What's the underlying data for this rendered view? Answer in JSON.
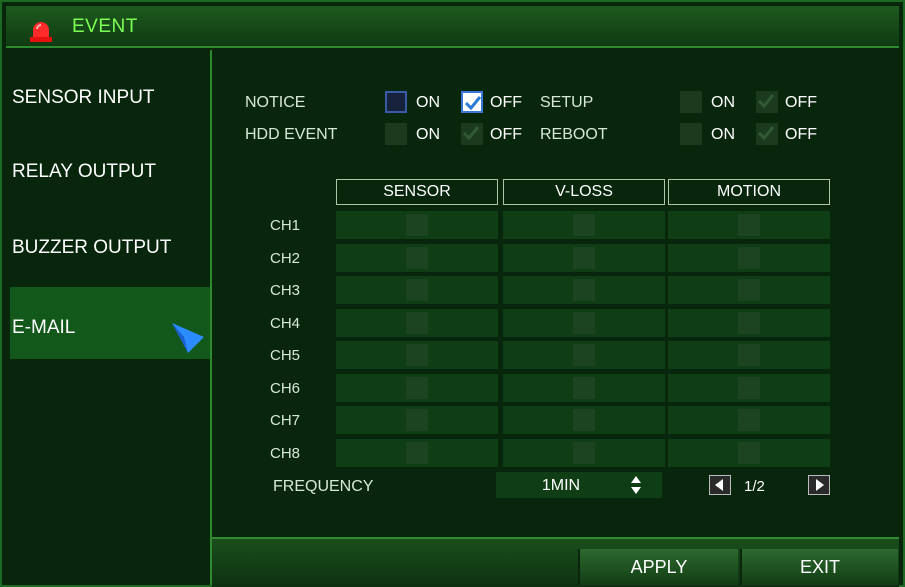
{
  "window": {
    "title": "EVENT",
    "title_color": "#7cff54",
    "icon": "alarm-siren-icon"
  },
  "sidebar": {
    "items": [
      {
        "label": "SENSOR INPUT"
      },
      {
        "label": "RELAY OUTPUT"
      },
      {
        "label": "BUZZER OUTPUT"
      },
      {
        "label": "E-MAIL",
        "active": true
      }
    ]
  },
  "options": {
    "notice": {
      "label": "NOTICE",
      "on": "ON",
      "off": "OFF",
      "selected": "OFF"
    },
    "hdd_event": {
      "label": "HDD EVENT",
      "on": "ON",
      "off": "OFF",
      "selected": "OFF",
      "disabled": true
    },
    "setup": {
      "label": "SETUP",
      "on": "ON",
      "off": "OFF",
      "selected": "OFF",
      "disabled": true
    },
    "reboot": {
      "label": "REBOOT",
      "on": "ON",
      "off": "OFF",
      "selected": "OFF",
      "disabled": true
    }
  },
  "table": {
    "columns": [
      "SENSOR",
      "V-LOSS",
      "MOTION"
    ],
    "rows": [
      "CH1",
      "CH2",
      "CH3",
      "CH4",
      "CH5",
      "CH6",
      "CH7",
      "CH8"
    ]
  },
  "frequency": {
    "label": "FREQUENCY",
    "value": "1MIN"
  },
  "pagination": {
    "page": "1/2"
  },
  "buttons": {
    "apply": "APPLY",
    "exit": "EXIT"
  },
  "colors": {
    "accent": "#7cff54",
    "background": "#07260c",
    "active_item": "#12581b",
    "arrow": "#2a8cff"
  }
}
